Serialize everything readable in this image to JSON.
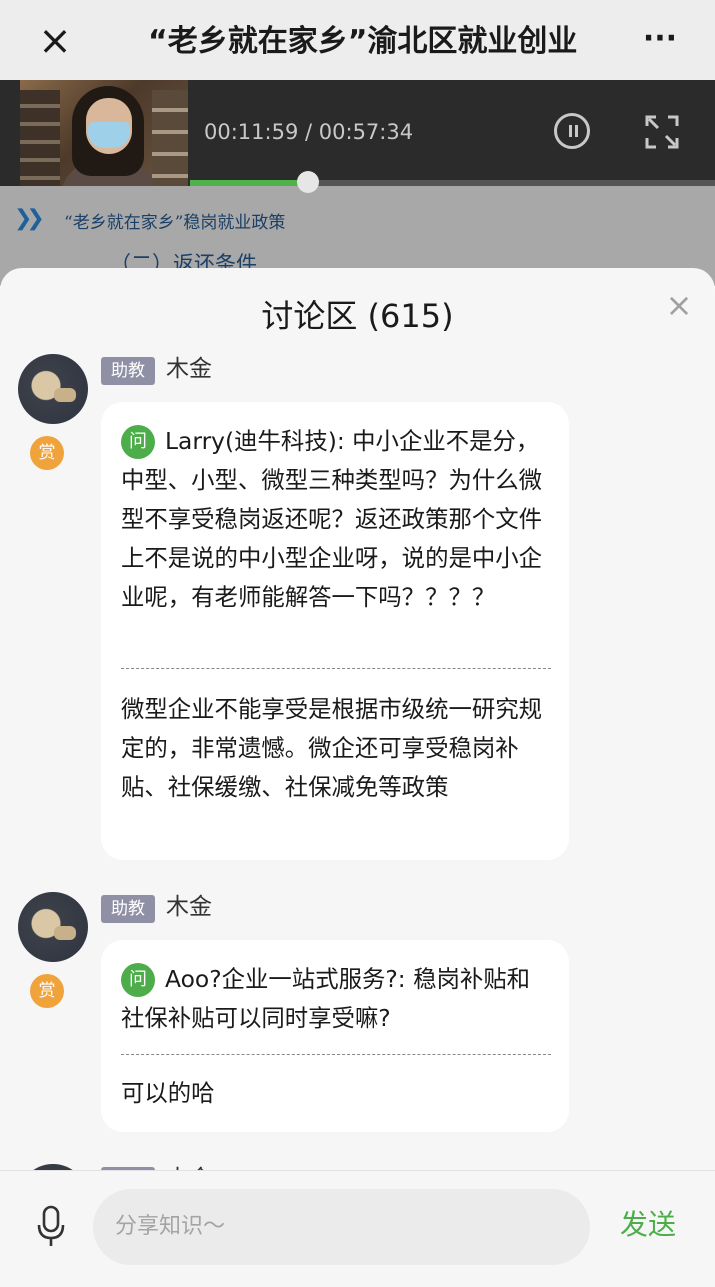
{
  "nav": {
    "title": "“老乡就在家乡”渝北区就业创业",
    "close_icon": "close-icon",
    "more_icon": "more-dots-icon"
  },
  "video": {
    "current_time": "00:11:59",
    "separator": " / ",
    "duration": "00:57:34",
    "progress_fraction": 0.208,
    "accent_color": "#4fb34a"
  },
  "slide": {
    "title": "“老乡就在家乡”稳岗就业政策",
    "subtitle": "（二）返还条件"
  },
  "discussion": {
    "title": "讨论区 (615)",
    "posts": [
      {
        "role": "助教",
        "name": "木金",
        "reward_label": "赏",
        "q_label": "问",
        "question": "Larry(迪牛科技): 中小企业不是分，中型、小型、微型三种类型吗？为什么微型不享受稳岗返还呢？返还政策那个文件上不是说的中小型企业呀，说的是中小企业呢，有老师能解答一下吗？？？？",
        "answer": "微型企业不能享受是根据市级统一研究规定的，非常遗憾。微企还可享受稳岗补贴、社保缓缴、社保减免等政策"
      },
      {
        "role": "助教",
        "name": "木金",
        "reward_label": "赏",
        "q_label": "问",
        "question": "Aoo?企业一站式服务?: 稳岗补贴和社保补贴可以同时享受嘛?",
        "answer": "可以的哈"
      },
      {
        "role": "助教",
        "name": "木金"
      }
    ]
  },
  "input": {
    "placeholder": "分享知识～",
    "send_label": "发送",
    "mic_icon": "microphone-icon"
  }
}
